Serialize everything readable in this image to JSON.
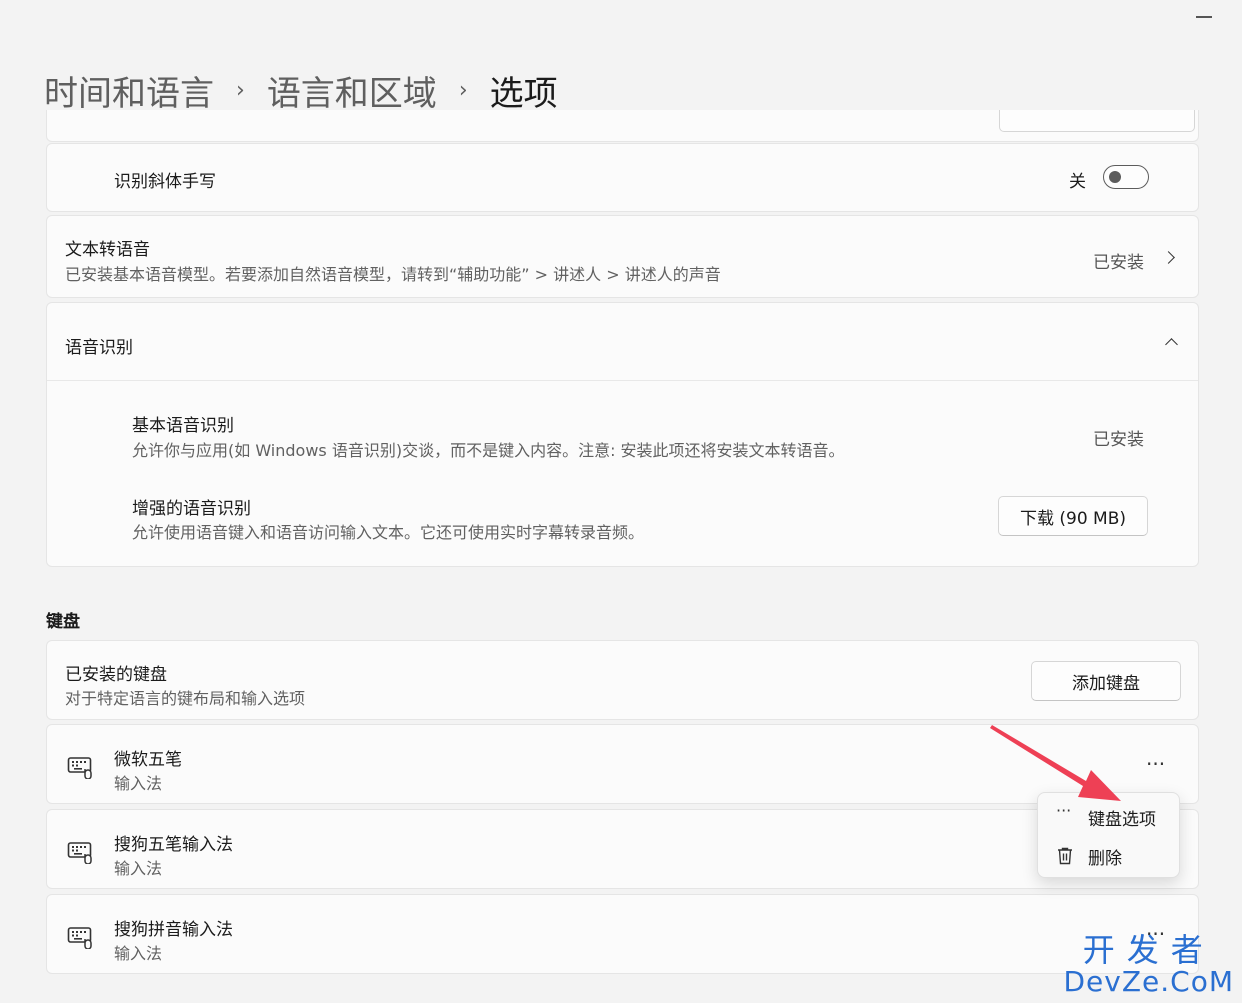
{
  "breadcrumb": {
    "item1": "时间和语言",
    "item2": "语言和区域",
    "current": "选项"
  },
  "handwriting": {
    "label": "识别斜体手写",
    "toggle_state": "关",
    "toggle_on": false
  },
  "tts": {
    "title": "文本转语音",
    "desc": "已安装基本语音模型。若要添加自然语音模型，请转到“辅助功能” > 讲述人 > 讲述人的声音",
    "status": "已安装"
  },
  "speech": {
    "title": "语音识别",
    "basic_title": "基本语音识别",
    "basic_desc": "允许你与应用(如 Windows 语音识别)交谈，而不是键入内容。注意: 安装此项还将安装文本转语音。",
    "basic_status": "已安装",
    "enhanced_title": "增强的语音识别",
    "enhanced_desc": "允许使用语音键入和语音访问输入文本。它还可使用实时字幕转录音频。",
    "download_label": "下载 (90 MB)"
  },
  "keyboard": {
    "section_title": "键盘",
    "installed_title": "已安装的键盘",
    "installed_desc": "对于特定语言的键布局和输入选项",
    "add_label": "添加键盘",
    "items": [
      {
        "name": "微软五笔",
        "type": "输入法"
      },
      {
        "name": "搜狗五笔输入法",
        "type": "输入法"
      },
      {
        "name": "搜狗拼音输入法",
        "type": "输入法"
      }
    ],
    "more_label": "···"
  },
  "context_menu": {
    "options_label": "键盘选项",
    "delete_label": "删除"
  },
  "watermark": {
    "top": "开发者",
    "bottom": "DevZe.CoM"
  },
  "colors": {
    "arrow": "#ee4055",
    "watermark": "#2a6fd1"
  },
  "icons": [
    "keyboard-icon",
    "trash-icon",
    "more-icon",
    "chevron-right-icon",
    "chevron-up-icon"
  ]
}
